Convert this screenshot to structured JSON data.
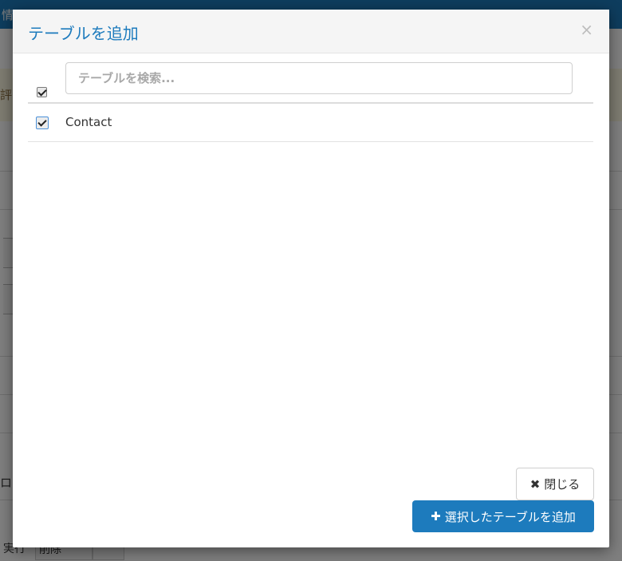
{
  "background": {
    "topbar_text": "情",
    "alert_text": "評",
    "side_label": "ロク",
    "bottom_buttons": [
      "実行",
      "削除"
    ]
  },
  "modal": {
    "title": "テーブルを追加",
    "close_glyph": "×",
    "search_placeholder": "テーブルを検索...",
    "select_all_checked": true,
    "tables": [
      {
        "name": "Contact",
        "checked": true
      }
    ],
    "close_button_label": "閉じる",
    "close_button_icon": "times-icon",
    "add_button_label": "選択したテーブルを追加",
    "add_button_icon": "plus-icon"
  },
  "colors": {
    "accent": "#1d7bbd",
    "overlay": "rgba(0,0,0,0.5)"
  }
}
